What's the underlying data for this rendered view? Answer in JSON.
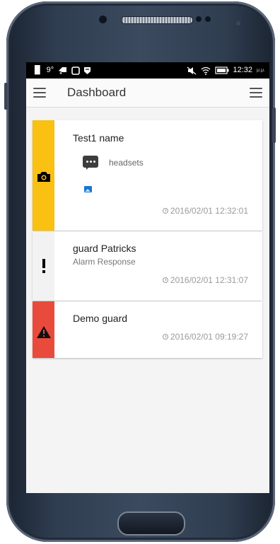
{
  "statusbar": {
    "signal": "▐▌",
    "temp": "9°",
    "time": "12:32",
    "time_suffix": "μ.μ."
  },
  "appbar": {
    "title": "Dashboard"
  },
  "cards": [
    {
      "title": "Test1 name",
      "message": "headsets",
      "timestamp": "2016/02/01 12:32:01",
      "strip_color": "#fac012",
      "icon": "camera-icon"
    },
    {
      "title": "guard Patricks",
      "subtitle": "Alarm Response",
      "timestamp": "2016/02/01 12:31:07",
      "strip_color": "#f2f2f2",
      "icon": "exclamation-icon"
    },
    {
      "title": "Demo guard",
      "timestamp": "2016/02/01 09:19:27",
      "strip_color": "#e84b3c",
      "icon": "warning-icon"
    }
  ]
}
